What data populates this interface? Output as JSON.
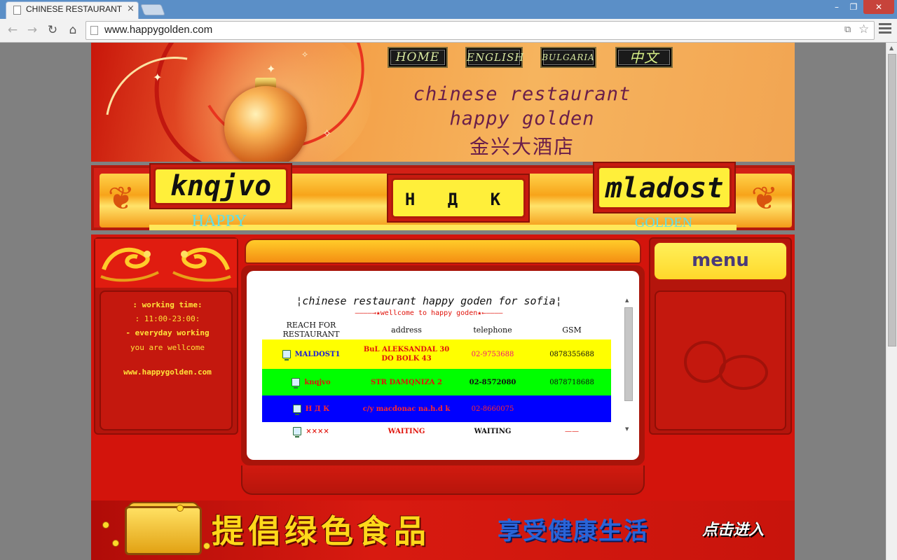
{
  "browser": {
    "tab_title": "CHINESE RESTAURANT",
    "tab_close": "×",
    "window_min": "–",
    "window_max": "❐",
    "window_close": "✕",
    "url": "www.happygolden.com",
    "icons": [
      "back-icon",
      "forward-icon",
      "reload-icon",
      "home-icon",
      "page-icon",
      "translate-icon",
      "star-icon",
      "menu-icon"
    ]
  },
  "header": {
    "nav": [
      "HOME",
      "ENGLISH",
      "BULGARIA",
      "中文"
    ],
    "title_line1": "chinese restaurant",
    "title_line2": "happy golden",
    "title_line3": "金兴大酒店"
  },
  "branches": {
    "left": "knqjvo",
    "center": "Н Д К",
    "right": "mladost",
    "label_left": "HAPPY",
    "label_right": "GOLDEN"
  },
  "sidebar": {
    "line1": ": working time:",
    "line2": ": 11:00-23:00:",
    "line3": "- everyday working",
    "line4": "you are wellcome",
    "line5": "www.happygolden.com"
  },
  "content": {
    "greeting": "¦chinese restaurant happy goden for sofia¦",
    "welcome": "————→★wellcome to happy goden★←————",
    "columns": [
      "REACH FOR RESTAURANT",
      "address",
      "telephone",
      "GSM"
    ],
    "rows": [
      {
        "name": "MALDOST1",
        "address": "BuL ALEKSANDAL 30 DO BOLK 43",
        "telephone": "02-9753688",
        "gsm": "0878355688"
      },
      {
        "name": "knqjvo",
        "address": "STR DAMQNIZA 2",
        "telephone": "02-8572080",
        "gsm": "0878718688"
      },
      {
        "name": "Н Д К",
        "address": "c/y macdonac na.h.d k",
        "telephone": "02-8660075",
        "gsm": ""
      },
      {
        "name": "××××",
        "address": "WAITING",
        "telephone": "WAITING",
        "gsm": "——"
      }
    ]
  },
  "menu": {
    "heading": "menu"
  },
  "banner": {
    "text1": "提倡绿色食品",
    "text2": "享受健康生活",
    "text3": "点击进入"
  },
  "colors": {
    "site_red": "#d3140c",
    "gold": "#ffd24a",
    "row_yellow": "#ffff00",
    "row_green": "#00ff00",
    "row_blue": "#0000ff",
    "label_cyan": "#5fe0e8"
  }
}
